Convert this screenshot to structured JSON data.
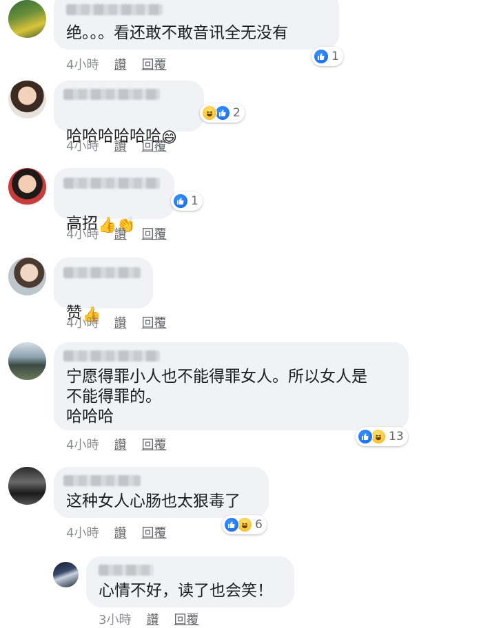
{
  "comments": [
    {
      "text": "绝。。。看还敢不敢音讯全无没有",
      "time": "4小時",
      "like": "讚",
      "reply": "回覆",
      "reaction_count": "1",
      "reactions": [
        "like-icon"
      ]
    },
    {
      "text": "哈哈哈哈哈哈",
      "emoji": "😄",
      "time": "4小時",
      "like": "讚",
      "reply": "回覆",
      "reaction_count": "2",
      "reactions": [
        "haha-icon",
        "like-icon"
      ]
    },
    {
      "text": "高招",
      "emoji": "👍👏",
      "time": "4小時",
      "like": "讚",
      "reply": "回覆",
      "reaction_count": "1",
      "reactions": [
        "like-icon"
      ]
    },
    {
      "text": "赞",
      "emoji": "👍",
      "time": "4小時",
      "like": "讚",
      "reply": "回覆"
    },
    {
      "text": "宁愿得罪小人也不能得罪女人。所以女人是\n不能得罪的。\n哈哈哈",
      "time": "4小時",
      "like": "讚",
      "reply": "回覆",
      "reaction_count": "13",
      "reactions": [
        "like-icon",
        "haha-icon"
      ]
    },
    {
      "text": "这种女人心肠也太狠毒了",
      "time": "4小時",
      "like": "讚",
      "reply": "回覆",
      "reaction_count": "6",
      "reactions": [
        "like-icon",
        "haha-icon"
      ]
    },
    {
      "text": "心情不好，读了也会笑！",
      "time": "3小時",
      "like": "讚",
      "reply": "回覆"
    }
  ],
  "colors": {
    "bubble": "#f0f2f5",
    "like_blue": "#1877f2",
    "meta_gray": "#8a8d91"
  }
}
